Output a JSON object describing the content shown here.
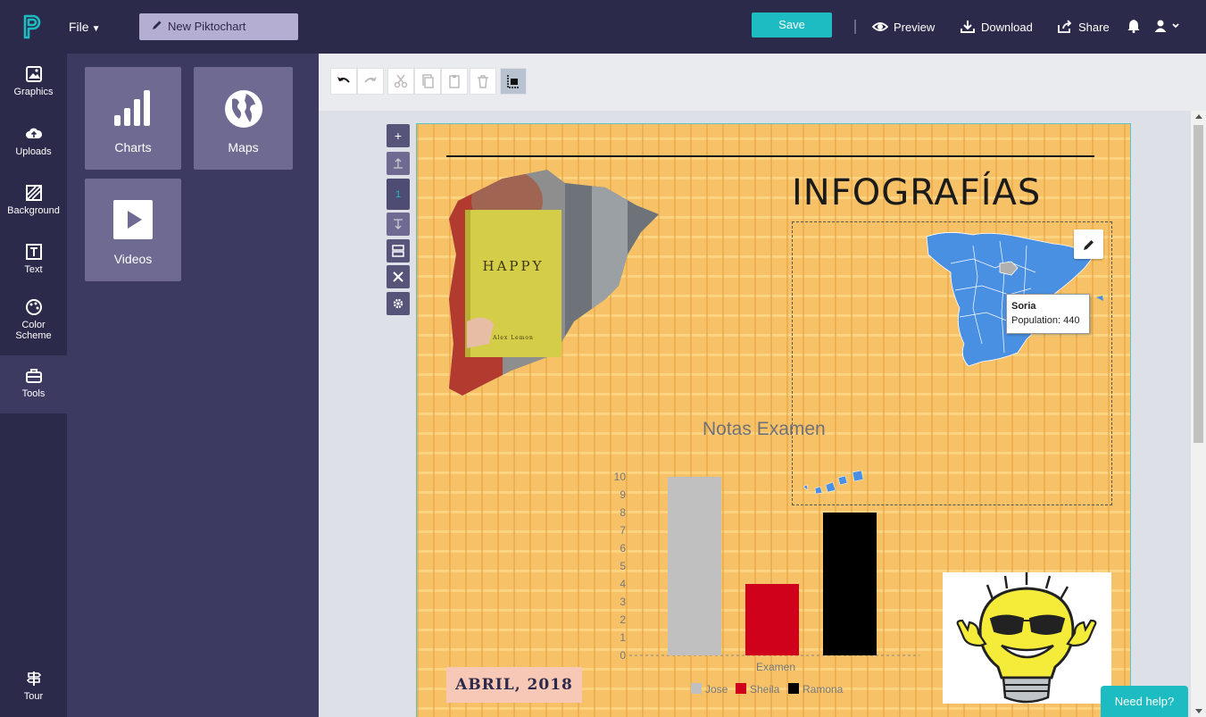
{
  "topbar": {
    "file_label": "File",
    "document_title": "New Piktochart",
    "save_label": "Save",
    "preview_label": "Preview",
    "download_label": "Download",
    "share_label": "Share"
  },
  "rail": {
    "items": [
      {
        "label": "Graphics",
        "icon": "image-icon"
      },
      {
        "label": "Uploads",
        "icon": "cloud-upload-icon"
      },
      {
        "label": "Background",
        "icon": "background-icon"
      },
      {
        "label": "Text",
        "icon": "text-icon"
      },
      {
        "label": "Color",
        "label2": "Scheme",
        "icon": "palette-icon"
      },
      {
        "label": "Tools",
        "icon": "toolbox-icon"
      },
      {
        "label": "Tour",
        "icon": "signpost-icon"
      }
    ]
  },
  "tools_panel": {
    "tiles": [
      {
        "label": "Charts",
        "icon": "bar-chart-icon"
      },
      {
        "label": "Maps",
        "icon": "globe-icon"
      },
      {
        "label": "Videos",
        "icon": "play-icon"
      }
    ]
  },
  "side_controls": {
    "page_number": "1"
  },
  "canvas": {
    "title": "INFOGRAFÍAS",
    "book_text": "HAPPY",
    "book_author": "Alex Lemon",
    "date_badge": "ABRIL, 2018",
    "map_tooltip": {
      "region": "Soria",
      "text": "Population: 440"
    },
    "colors": {
      "background": "#f7c267",
      "map_fill": "#4a90e2",
      "map_highlight": "#b0b0b0"
    }
  },
  "chart_data": {
    "type": "bar",
    "title": "Notas Examen",
    "xlabel": "Examen",
    "ylabel": "",
    "ylim": [
      0,
      10
    ],
    "yticks": [
      0,
      1,
      2,
      3,
      4,
      5,
      6,
      7,
      8,
      9,
      10
    ],
    "categories": [
      "Examen"
    ],
    "series": [
      {
        "name": "Jose",
        "values": [
          10
        ],
        "color": "#c0c0c0"
      },
      {
        "name": "Sheila",
        "values": [
          4
        ],
        "color": "#d0021b"
      },
      {
        "name": "Ramona",
        "values": [
          8
        ],
        "color": "#000000"
      }
    ],
    "legend": "bottom"
  },
  "help": {
    "label": "Need help?"
  }
}
